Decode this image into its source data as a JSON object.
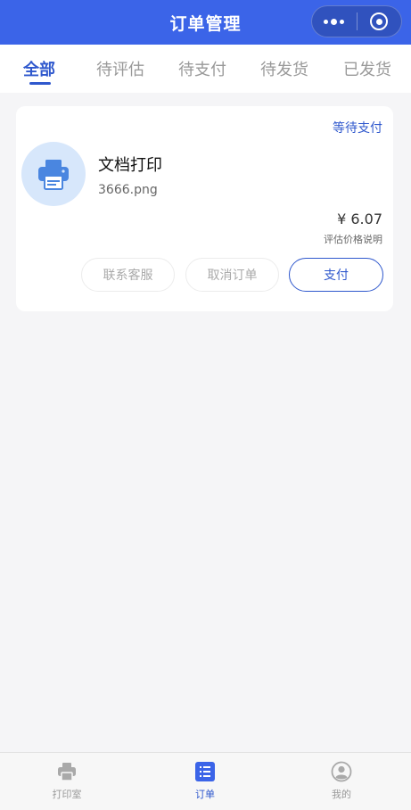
{
  "header": {
    "title": "订单管理"
  },
  "tabs": [
    {
      "label": "全部",
      "active": true
    },
    {
      "label": "待评估",
      "active": false
    },
    {
      "label": "待支付",
      "active": false
    },
    {
      "label": "待发货",
      "active": false
    },
    {
      "label": "已发货",
      "active": false
    }
  ],
  "order": {
    "status": "等待支付",
    "icon": "printer-icon",
    "title": "文档打印",
    "file_name": "3666.png",
    "price": "¥ 6.07",
    "price_note": "评估价格说明",
    "buttons": {
      "contact": "联系客服",
      "cancel": "取消订单",
      "pay": "支付"
    }
  },
  "bottom_nav": [
    {
      "label": "打印室",
      "icon": "printer-icon"
    },
    {
      "label": "订单",
      "icon": "order-list-icon",
      "active": true
    },
    {
      "label": "我的",
      "icon": "user-icon"
    }
  ],
  "colors": {
    "primary": "#3b64e8",
    "accent": "#2f58cd",
    "printer_bg": "#d7e7fb",
    "printer_fg": "#4a86e0"
  }
}
